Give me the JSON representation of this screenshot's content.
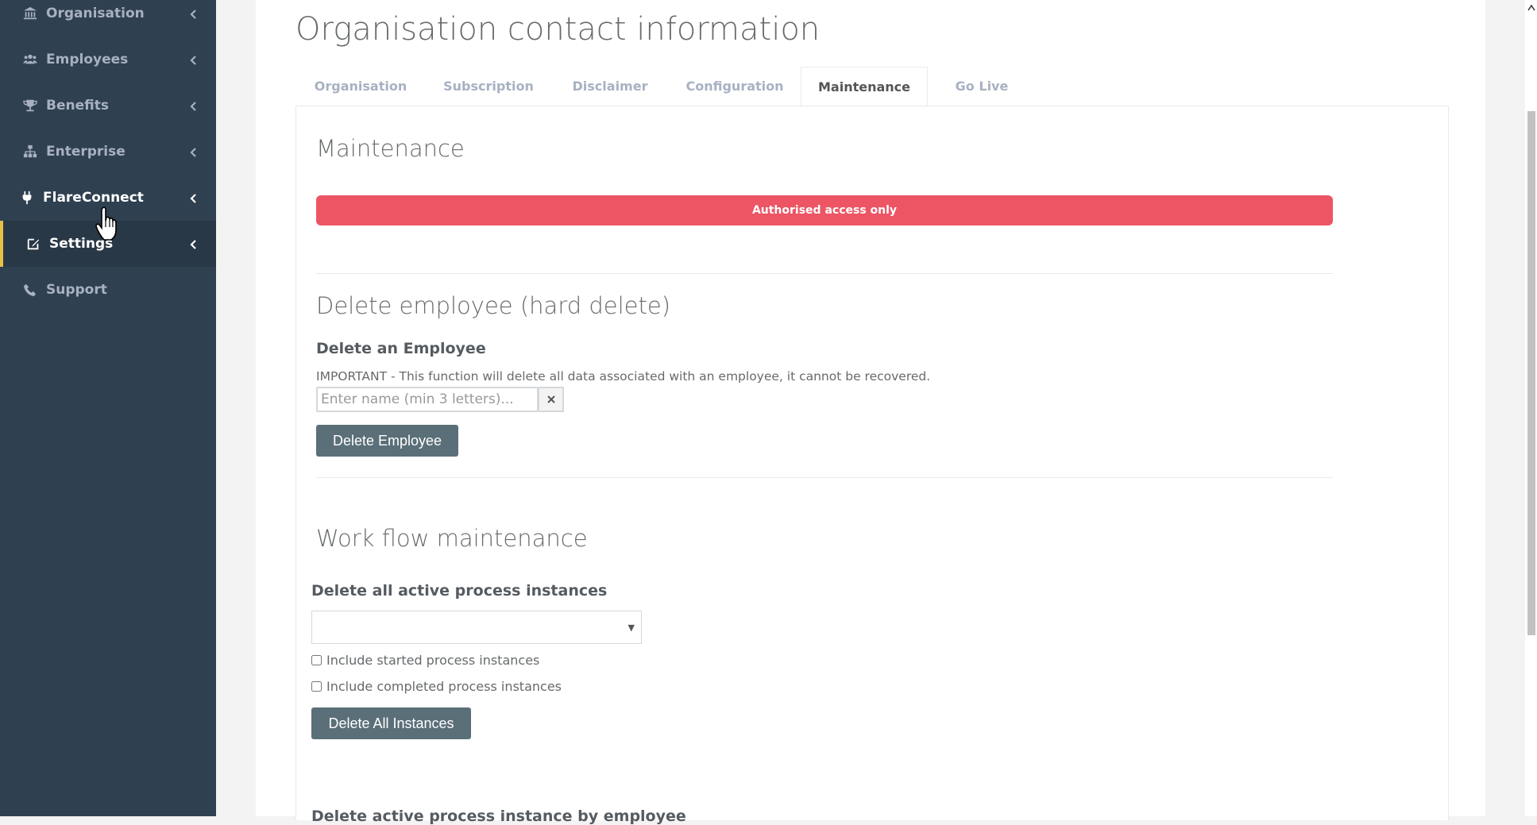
{
  "sidebar": {
    "items": [
      {
        "label": "Organisation",
        "icon": "bank-icon"
      },
      {
        "label": "Employees",
        "icon": "users-icon"
      },
      {
        "label": "Benefits",
        "icon": "trophy-icon"
      },
      {
        "label": "Enterprise",
        "icon": "sitemap-icon"
      },
      {
        "label": "FlareConnect",
        "icon": "plug-icon"
      },
      {
        "label": "Settings",
        "icon": "edit-icon"
      },
      {
        "label": "Support",
        "icon": "phone-icon"
      }
    ],
    "active": "Settings",
    "hovered": "FlareConnect"
  },
  "page": {
    "title": "Organisation contact information"
  },
  "tabs": [
    {
      "label": "Organisation"
    },
    {
      "label": "Subscription"
    },
    {
      "label": "Disclaimer"
    },
    {
      "label": "Configuration"
    },
    {
      "label": "Maintenance",
      "active": true
    },
    {
      "label": "Go Live"
    }
  ],
  "maintenance": {
    "heading": "Maintenance",
    "alert": "Authorised access only",
    "alert_color": "#ed5565"
  },
  "delete_employee": {
    "heading": "Delete employee (hard delete)",
    "subheading": "Delete an Employee",
    "note": "IMPORTANT - This function will delete all data associated with an employee, it cannot be recovered.",
    "input_placeholder": "Enter name (min 3 letters)...",
    "clear_symbol": "×",
    "button": "Delete Employee"
  },
  "workflow": {
    "heading": "Work flow maintenance",
    "subheading": "Delete all active process instances",
    "select_value": "",
    "check_started": "Include started process instances",
    "check_completed": "Include completed process instances",
    "button": "Delete All Instances",
    "next_subheading": "Delete active process instance by employee"
  },
  "colors": {
    "sidebar_bg": "#2f4050",
    "active_border": "#e6c14a",
    "button_bg": "#5a6f78"
  }
}
